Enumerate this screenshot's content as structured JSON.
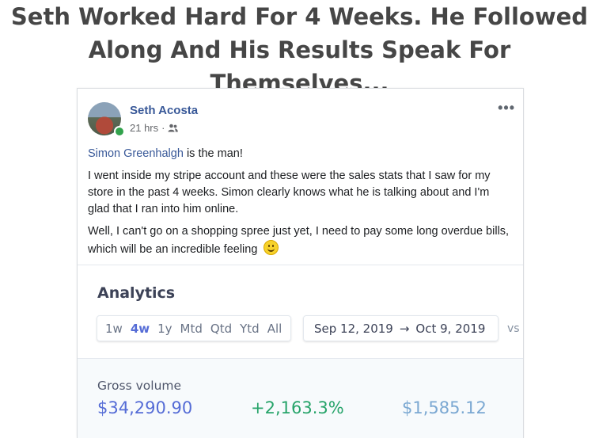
{
  "headline": {
    "line1": "Seth Worked Hard For 4 Weeks. He Followed",
    "line2": "Along And His Results Speak For Themselves..."
  },
  "post": {
    "author": "Seth Acosta",
    "time": "21 hrs",
    "meta_separator": "·",
    "audience_icon": "friends-icon",
    "more_icon": "•••",
    "mention": "Simon Greenhalgh",
    "line1_rest": " is the man!",
    "paragraph2": "I went inside my stripe account and these were the sales stats that I saw for my store in the past 4 weeks. Simon clearly knows what he is talking about and I'm glad that I ran into him online.",
    "paragraph3": "Well, I can't go on a shopping spree just yet, I need to pay some long overdue bills, which will be an incredible feeling",
    "emoji": "smiley-face-icon"
  },
  "analytics": {
    "title": "Analytics",
    "ranges": [
      "1w",
      "4w",
      "1y",
      "Mtd",
      "Qtd",
      "Ytd",
      "All"
    ],
    "active_range": "4w",
    "date_start": "Sep 12, 2019",
    "date_arrow": "→",
    "date_end": "Oct 9, 2019",
    "compare": "vs",
    "gross_label": "Gross volume",
    "gross_value": "$34,290.90",
    "gross_change": "+2,163.3%",
    "gross_previous": "$1,585.12"
  },
  "colors": {
    "link": "#385898",
    "accent": "#556cd6",
    "positive": "#27a46a",
    "online": "#31a24c"
  }
}
